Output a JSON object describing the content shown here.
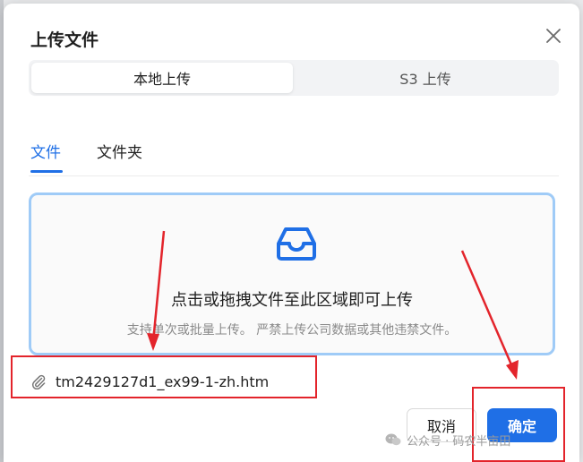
{
  "dialog": {
    "title": "上传文件",
    "close_icon": "close-icon"
  },
  "source_switch": {
    "options": [
      "本地上传",
      "S3 上传"
    ],
    "selected": "本地上传"
  },
  "tabs": {
    "items": [
      "文件",
      "文件夹"
    ],
    "active": "文件"
  },
  "dropzone": {
    "icon": "inbox-icon",
    "main_text": "点击或拖拽文件至此区域即可上传",
    "hint_text": "支持单次或批量上传。 严禁上传公司数据或其他违禁文件。"
  },
  "file_list": [
    {
      "icon": "paperclip-icon",
      "name": "tm2429127d1_ex99-1-zh.htm"
    }
  ],
  "footer": {
    "cancel_label": "取消",
    "confirm_label": "确定"
  },
  "watermark": {
    "text": "公众号 · 码农半亩田"
  },
  "colors": {
    "accent": "#1f6fe6",
    "annotation": "#e3242b",
    "dropzone_border": "#9fcbf7"
  }
}
